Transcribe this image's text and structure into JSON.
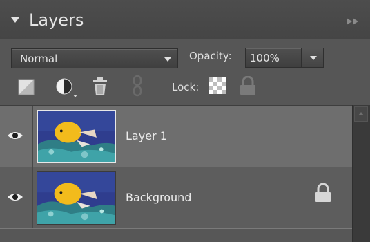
{
  "header": {
    "title": "Layers",
    "collapse_icon": "triangle-down-icon",
    "menu_icon": "fast-forward-icon"
  },
  "toolbar": {
    "blend_mode": "Normal",
    "opacity_label": "Opacity:",
    "opacity_value": "100%",
    "lock_label": "Lock:",
    "icons": [
      "new-layer-icon",
      "adjustment-layer-icon",
      "trash-icon",
      "link-icon",
      "lock-transparency-icon",
      "lock-all-icon"
    ]
  },
  "layers": [
    {
      "name": "Layer 1",
      "selected": true,
      "visible": true,
      "locked": false
    },
    {
      "name": "Background",
      "selected": false,
      "visible": true,
      "locked": true
    }
  ],
  "colors": {
    "panel_bg": "#565656",
    "header_bg": "#4a4a4a",
    "selected_row": "#6e6e6e",
    "text": "#e6e6e6"
  }
}
